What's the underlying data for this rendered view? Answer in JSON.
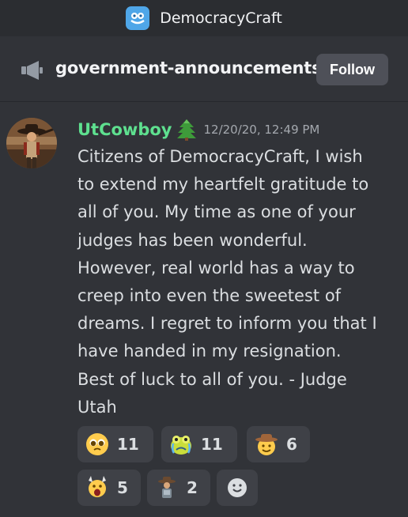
{
  "header": {
    "server_name": "DemocracyCraft",
    "server_icon": "server-logo-icon"
  },
  "channel": {
    "name": "government-announcements",
    "icon": "megaphone-icon",
    "follow_label": "Follow"
  },
  "message": {
    "author": "UtCowboy",
    "author_color": "#5ee08f",
    "badge_icon": "pine-tree-icon",
    "timestamp": "12/20/20, 12:49 PM",
    "text": "Citizens of DemocracyCraft, I wish to extend my heartfelt gratitude to all of you. My time as one of your judges has been wonderful. However, real world has a way to creep into even the sweetest of dreams. I regret to inform you that I have handed in my resignation. Best of luck to all of you. - Judge Utah"
  },
  "reactions": [
    {
      "icon": "pleading-face-icon",
      "count": "11"
    },
    {
      "icon": "crying-emoji-icon",
      "count": "11"
    },
    {
      "icon": "cowboy-face-icon",
      "count": "6"
    },
    {
      "icon": "screaming-face-icon",
      "count": "5"
    },
    {
      "icon": "cowboy-character-icon",
      "count": "2"
    }
  ],
  "add_reaction_icon": "add-reaction-smiley-icon",
  "colors": {
    "background": "#313338",
    "topbar": "#2b2d31",
    "reaction_bg": "#3f4147",
    "button_bg": "#4e5058"
  }
}
